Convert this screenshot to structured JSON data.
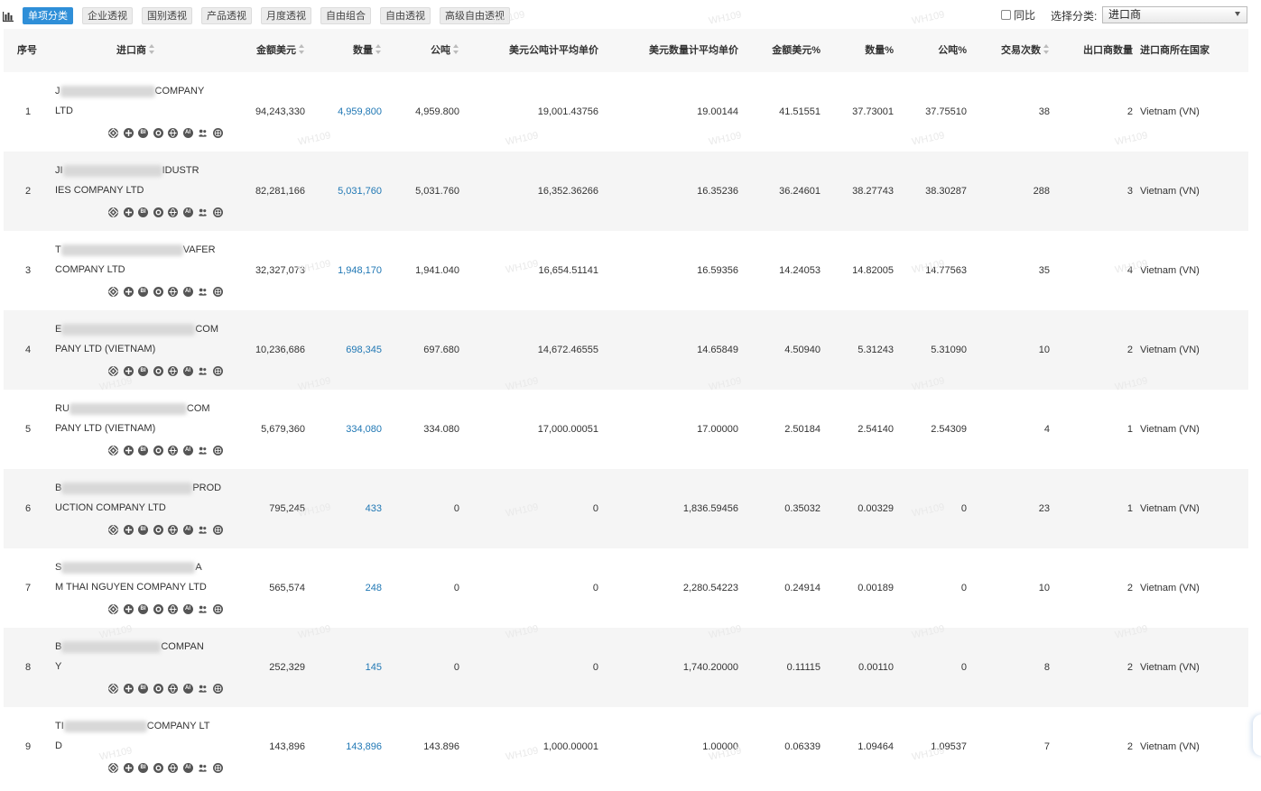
{
  "toolbar": {
    "tabs": [
      "单项分类",
      "企业透视",
      "国别透视",
      "产品透视",
      "月度透视",
      "自由组合",
      "自由透视",
      "高级自由透视"
    ],
    "compare_label": "同比",
    "category_label": "选择分类:",
    "category_value": "进口商"
  },
  "table": {
    "headers": {
      "index": "序号",
      "importer": "进口商",
      "amount": "金额美元",
      "qty": "数量",
      "ton": "公吨",
      "usd_per_ton": "美元公吨计平均单价",
      "usd_per_qty": "美元数量计平均单价",
      "amount_pct": "金额美元%",
      "qty_pct": "数量%",
      "ton_pct": "公吨%",
      "trades": "交易次数",
      "exporters": "出口商数量",
      "country": "进口商所在国家"
    },
    "rows": [
      {
        "idx": "1",
        "n1a": "J",
        "n1b": "COMPANY",
        "n2": "LTD",
        "amount": "94,243,330",
        "qty": "4,959,800",
        "ton": "4,959.800",
        "upt": "19,001.43756",
        "upq": "19.00144",
        "ap": "41.51551",
        "qp": "37.73001",
        "tp": "37.75510",
        "tr": "38",
        "ex": "2",
        "country": "Vietnam (VN)"
      },
      {
        "idx": "2",
        "n1a": "JI",
        "n1b": "IDUSTR",
        "n2": "IES COMPANY LTD",
        "amount": "82,281,166",
        "qty": "5,031,760",
        "ton": "5,031.760",
        "upt": "16,352.36266",
        "upq": "16.35236",
        "ap": "36.24601",
        "qp": "38.27743",
        "tp": "38.30287",
        "tr": "288",
        "ex": "3",
        "country": "Vietnam (VN)"
      },
      {
        "idx": "3",
        "n1a": "T",
        "n1b": "VAFER",
        "n2": "COMPANY LTD",
        "amount": "32,327,073",
        "qty": "1,948,170",
        "ton": "1,941.040",
        "upt": "16,654.51141",
        "upq": "16.59356",
        "ap": "14.24053",
        "qp": "14.82005",
        "tp": "14.77563",
        "tr": "35",
        "ex": "4",
        "country": "Vietnam (VN)"
      },
      {
        "idx": "4",
        "n1a": "E",
        "n1b": "COM",
        "n2": "PANY LTD (VIETNAM)",
        "amount": "10,236,686",
        "qty": "698,345",
        "ton": "697.680",
        "upt": "14,672.46555",
        "upq": "14.65849",
        "ap": "4.50940",
        "qp": "5.31243",
        "tp": "5.31090",
        "tr": "10",
        "ex": "2",
        "country": "Vietnam (VN)"
      },
      {
        "idx": "5",
        "n1a": "RU",
        "n1b": "COM",
        "n2": "PANY LTD (VIETNAM)",
        "amount": "5,679,360",
        "qty": "334,080",
        "ton": "334.080",
        "upt": "17,000.00051",
        "upq": "17.00000",
        "ap": "2.50184",
        "qp": "2.54140",
        "tp": "2.54309",
        "tr": "4",
        "ex": "1",
        "country": "Vietnam (VN)"
      },
      {
        "idx": "6",
        "n1a": "B",
        "n1b": "PROD",
        "n2": "UCTION COMPANY LTD",
        "amount": "795,245",
        "qty": "433",
        "ton": "0",
        "upt": "0",
        "upq": "1,836.59456",
        "ap": "0.35032",
        "qp": "0.00329",
        "tp": "0",
        "tr": "23",
        "ex": "1",
        "country": "Vietnam (VN)"
      },
      {
        "idx": "7",
        "n1a": "S",
        "n1b": "A",
        "n2": "M THAI NGUYEN COMPANY LTD",
        "amount": "565,574",
        "qty": "248",
        "ton": "0",
        "upt": "0",
        "upq": "2,280.54223",
        "ap": "0.24914",
        "qp": "0.00189",
        "tp": "0",
        "tr": "10",
        "ex": "2",
        "country": "Vietnam (VN)"
      },
      {
        "idx": "8",
        "n1a": "B",
        "n1b": "COMPAN",
        "n2": "Y",
        "amount": "252,329",
        "qty": "145",
        "ton": "0",
        "upt": "0",
        "upq": "1,740.20000",
        "ap": "0.11115",
        "qp": "0.00110",
        "tp": "0",
        "tr": "8",
        "ex": "2",
        "country": "Vietnam (VN)"
      },
      {
        "idx": "9",
        "n1a": "TI",
        "n1b": "COMPANY LT",
        "n2": "D",
        "amount": "143,896",
        "qty": "143,896",
        "ton": "143.896",
        "upt": "1,000.00001",
        "upq": "1.00000",
        "ap": "0.06339",
        "qp": "1.09464",
        "tp": "1.09537",
        "tr": "7",
        "ex": "2",
        "country": "Vietnam (VN)"
      }
    ],
    "row_icons": [
      "locate-icon",
      "compass-icon",
      "bi-icon",
      "record-icon",
      "globe-icon",
      "ai-icon",
      "people-icon",
      "web-icon"
    ],
    "icon_labels": {
      "bi": "BI",
      "ai": "AI"
    }
  },
  "watermark": "WH109"
}
